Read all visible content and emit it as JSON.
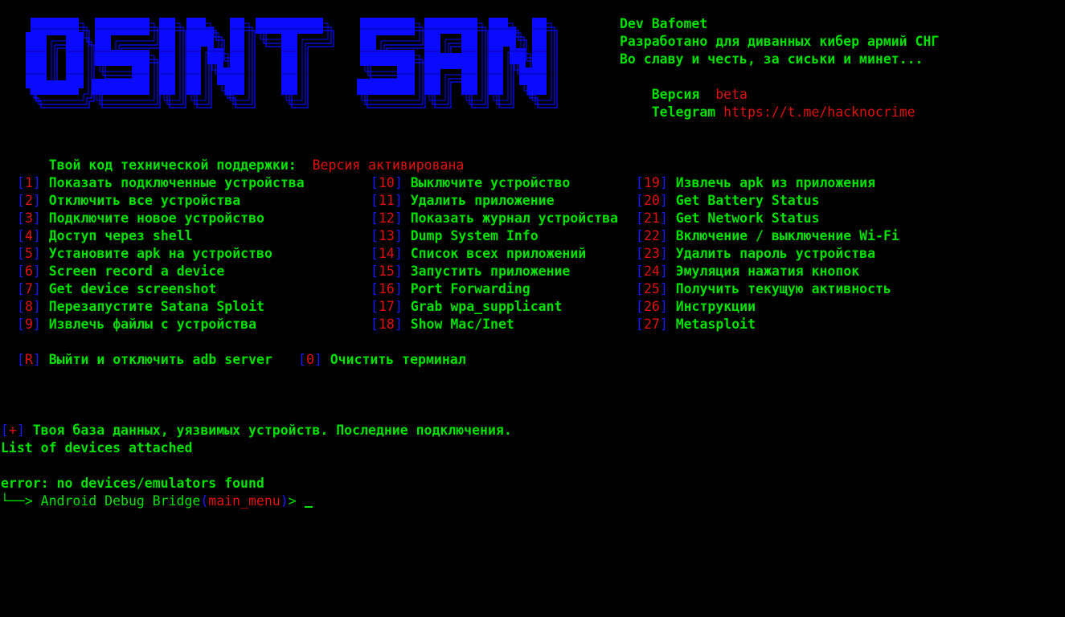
{
  "logo": {
    "text": "OSINT SAN",
    "color": "#0a0aff"
  },
  "header": {
    "dev": "Dev Bafomet",
    "developed_for": "Разработано для диванных кибер армий СНГ",
    "slogan": "Во славу и честь, за сиськи и минет...",
    "version_label": "Версия",
    "version_value": "beta",
    "telegram_label": "Telegram",
    "telegram_link": "https://t.me/hacknocrime"
  },
  "support": {
    "label": "Твой код технической поддержки:",
    "value": "Версия активирована"
  },
  "menu": {
    "col1": [
      {
        "key": "1",
        "label": "Показать подключенные устройства"
      },
      {
        "key": "2",
        "label": "Отключить все устройства"
      },
      {
        "key": "3",
        "label": "Подключите новое устройство"
      },
      {
        "key": "4",
        "label": "Доступ через shell"
      },
      {
        "key": "5",
        "label": "Установите apk на устройство"
      },
      {
        "key": "6",
        "label": "Screen record a device"
      },
      {
        "key": "7",
        "label": "Get device screenshot"
      },
      {
        "key": "8",
        "label": "Перезапустите Satana Sploit"
      },
      {
        "key": "9",
        "label": "Извлечь файлы с устройства"
      }
    ],
    "col2": [
      {
        "key": "10",
        "label": "Выключите устройство"
      },
      {
        "key": "11",
        "label": "Удалить приложение"
      },
      {
        "key": "12",
        "label": "Показать журнал устройства"
      },
      {
        "key": "13",
        "label": "Dump System Info"
      },
      {
        "key": "14",
        "label": "Список всех приложений"
      },
      {
        "key": "15",
        "label": "Запустить приложение"
      },
      {
        "key": "16",
        "label": "Port Forwarding"
      },
      {
        "key": "17",
        "label": "Grab wpa_supplicant"
      },
      {
        "key": "18",
        "label": "Show Mac/Inet"
      }
    ],
    "col3": [
      {
        "key": "19",
        "label": "Извлечь apk из приложения"
      },
      {
        "key": "20",
        "label": "Get Battery Status"
      },
      {
        "key": "21",
        "label": "Get Network Status"
      },
      {
        "key": "22",
        "label": "Включение / выключение Wi-Fi"
      },
      {
        "key": "23",
        "label": "Удалить пароль устройства"
      },
      {
        "key": "24",
        "label": "Эмуляция нажатия кнопок"
      },
      {
        "key": "25",
        "label": "Получить текущую активность"
      },
      {
        "key": "26",
        "label": "Инструкции"
      },
      {
        "key": "27",
        "label": "Metasploit"
      }
    ],
    "extra": [
      {
        "key": "R",
        "label": "Выйти и отключить adb server"
      },
      {
        "key": "0",
        "label": "Очистить терминал"
      }
    ]
  },
  "output": {
    "plus_marker": "+",
    "db_line": "Твоя база данных, уязвимых устройств. Последние подключения.",
    "list_header": "List of devices attached",
    "error": "error: no devices/emulators found"
  },
  "prompt": {
    "prefix": "└──> ",
    "name": "Android Debug Bridge",
    "context": "main_menu",
    "suffix": "> "
  },
  "colors": {
    "green": "#00e000",
    "red": "#e01010",
    "blue": "#1a1aff"
  }
}
